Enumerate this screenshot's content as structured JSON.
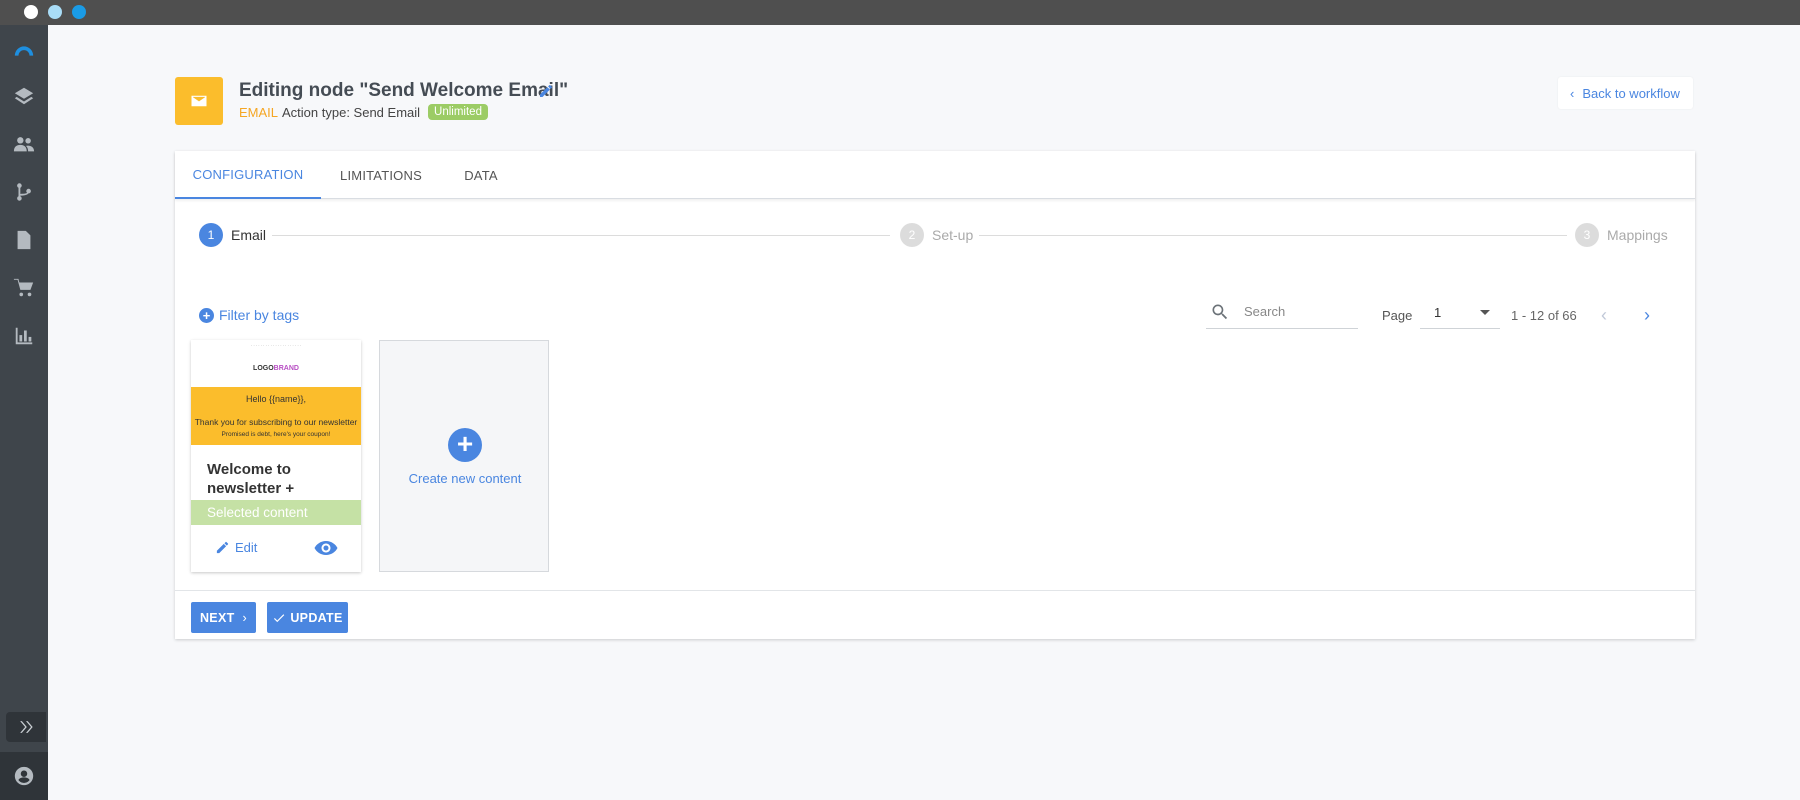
{
  "header": {
    "title": "Editing node \"Send Welcome Email\"",
    "type": "EMAIL",
    "action": "Action type: Send Email",
    "badge": "Unlimited",
    "back_label": "Back to workflow"
  },
  "tabs": [
    {
      "label": "CONFIGURATION",
      "active": true
    },
    {
      "label": "LIMITATIONS",
      "active": false
    },
    {
      "label": "DATA",
      "active": false
    }
  ],
  "steps": [
    {
      "num": "1",
      "label": "Email",
      "active": true
    },
    {
      "num": "2",
      "label": "Set-up",
      "active": false
    },
    {
      "num": "3",
      "label": "Mappings",
      "active": false
    }
  ],
  "toolbar": {
    "filter_label": "Filter by tags",
    "search_placeholder": "Search",
    "page_label": "Page",
    "page_value": "1",
    "range": "1 - 12 of 66"
  },
  "content_card": {
    "preview_hello": "Hello {{name}},",
    "preview_thanks": "Thank you for subscribing to our newsletter",
    "preview_coupon": "Promised is debt, here's your coupon!",
    "preview_logo": "LOGO",
    "preview_brand": "BRAND",
    "title": "Welcome to newsletter +",
    "selected_label": "Selected content",
    "edit_label": "Edit"
  },
  "create_card": {
    "label": "Create new content"
  },
  "footer": {
    "next_label": "NEXT",
    "update_label": "UPDATE"
  },
  "colors": {
    "accent": "#4a86e0",
    "email": "#fbbd2c",
    "badge": "#9ccc65",
    "selected": "#c5e1a5"
  }
}
